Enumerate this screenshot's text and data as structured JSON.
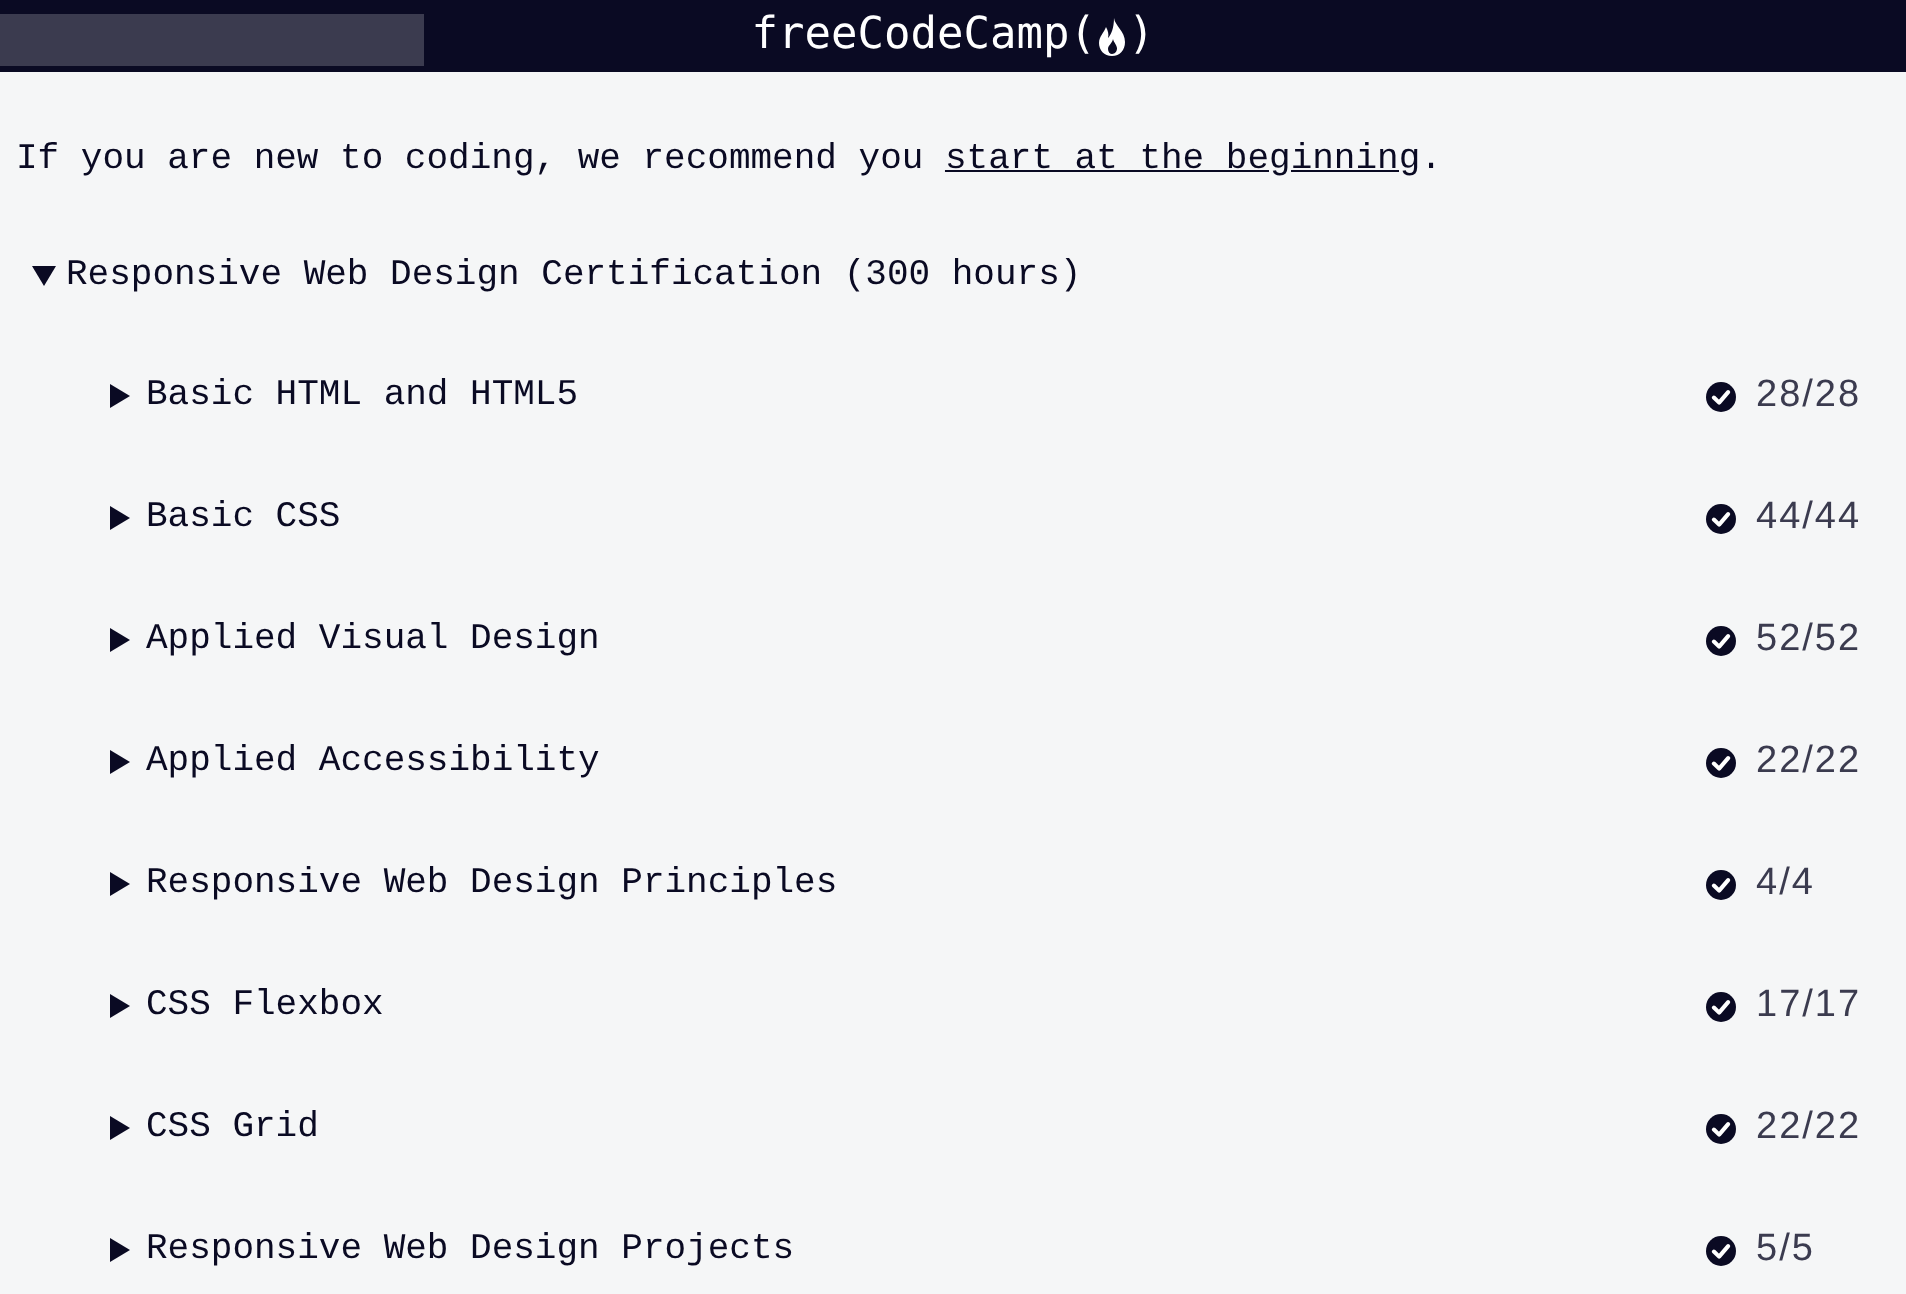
{
  "navbar": {
    "logo": {
      "text_before": "freeCodeCamp(",
      "text_after": ")"
    }
  },
  "intro": {
    "text_before": "If you are new to coding, we recommend you ",
    "link": "start at the beginning",
    "text_after": "."
  },
  "certification": {
    "title": "Responsive Web Design Certification (300 hours)",
    "expanded": true,
    "blocks": [
      {
        "title": "Basic HTML and HTML5",
        "expanded": false,
        "completed": true,
        "progress": "28/28"
      },
      {
        "title": "Basic CSS",
        "expanded": false,
        "completed": true,
        "progress": "44/44"
      },
      {
        "title": "Applied Visual Design",
        "expanded": false,
        "completed": true,
        "progress": "52/52"
      },
      {
        "title": "Applied Accessibility",
        "expanded": false,
        "completed": true,
        "progress": "22/22"
      },
      {
        "title": "Responsive Web Design Principles",
        "expanded": false,
        "completed": true,
        "progress": "4/4"
      },
      {
        "title": "CSS Flexbox",
        "expanded": false,
        "completed": true,
        "progress": "17/17"
      },
      {
        "title": "CSS Grid",
        "expanded": false,
        "completed": true,
        "progress": "22/22"
      },
      {
        "title": "Responsive Web Design Projects",
        "expanded": false,
        "completed": true,
        "progress": "5/5"
      }
    ]
  }
}
